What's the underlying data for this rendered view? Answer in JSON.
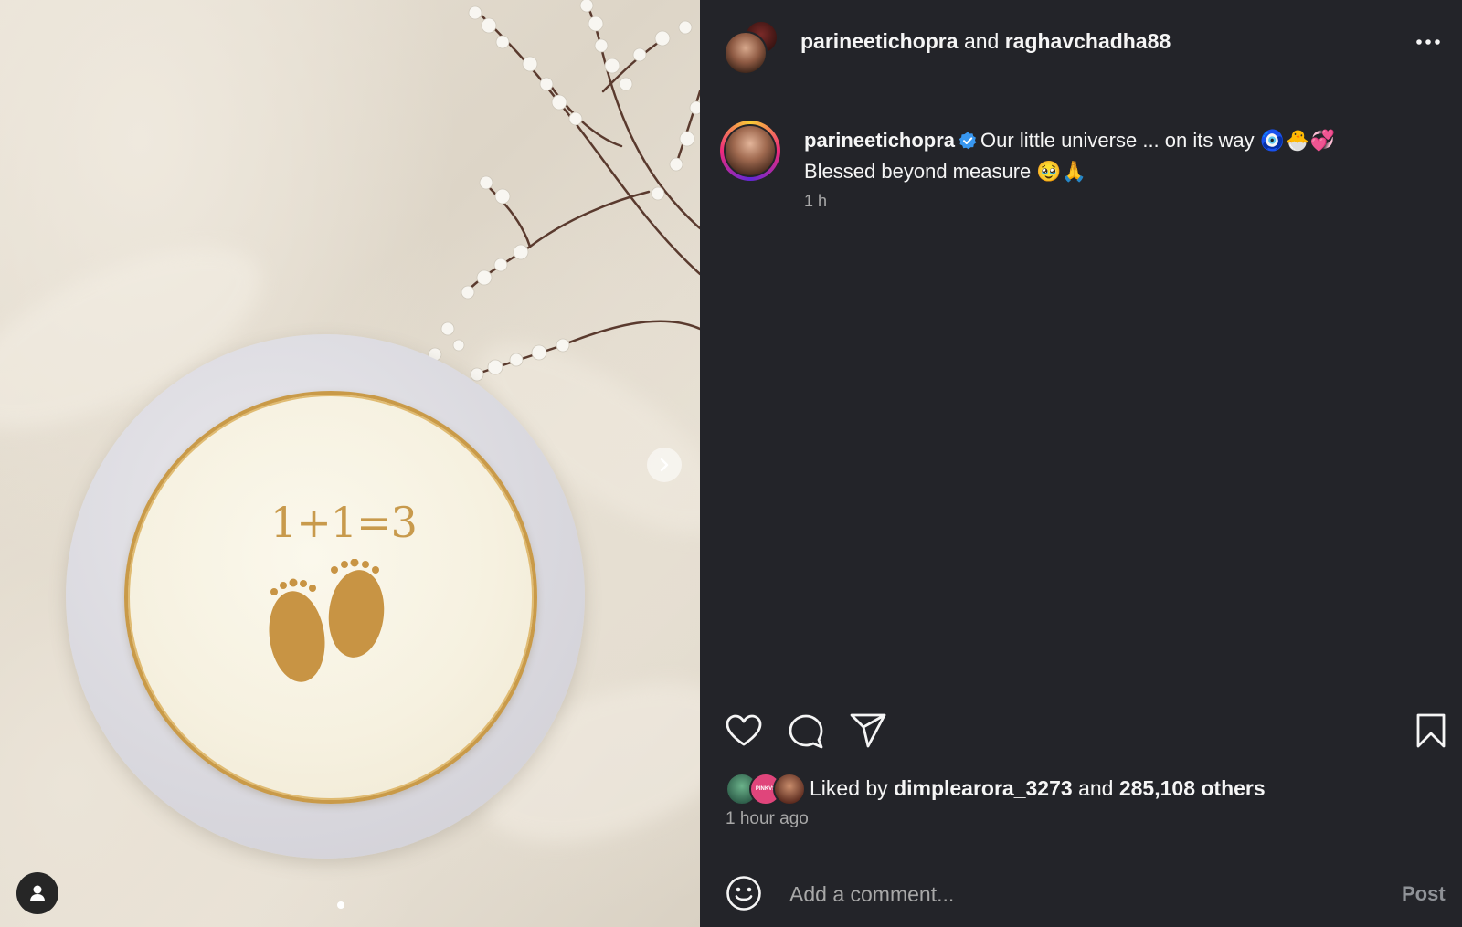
{
  "header": {
    "user1": "parineetichopra",
    "joiner": "and",
    "user2": "raghavchadha88"
  },
  "caption": {
    "username": "parineetichopra",
    "line1": "Our little universe ... on its way 🧿🐣💞",
    "line2": "Blessed beyond measure 🥹🙏",
    "time": "1 h"
  },
  "media": {
    "cake_text": "1+1=3"
  },
  "likes": {
    "prefix": "Liked by",
    "user": "dimplearora_3273",
    "joiner": "and",
    "others": "285,108 others",
    "avatar_badge": "PINKVS"
  },
  "time_ago": "1 hour ago",
  "comment": {
    "placeholder": "Add a comment...",
    "post_label": "Post"
  },
  "colors": {
    "panel_bg": "#232429",
    "verified": "#3897f0",
    "muted_text": "#a8a8a8"
  },
  "icons": [
    "more-options-icon",
    "verified-icon",
    "heart-icon",
    "comment-icon",
    "share-icon",
    "bookmark-icon",
    "emoji-icon",
    "chevron-right-icon",
    "user-icon"
  ]
}
